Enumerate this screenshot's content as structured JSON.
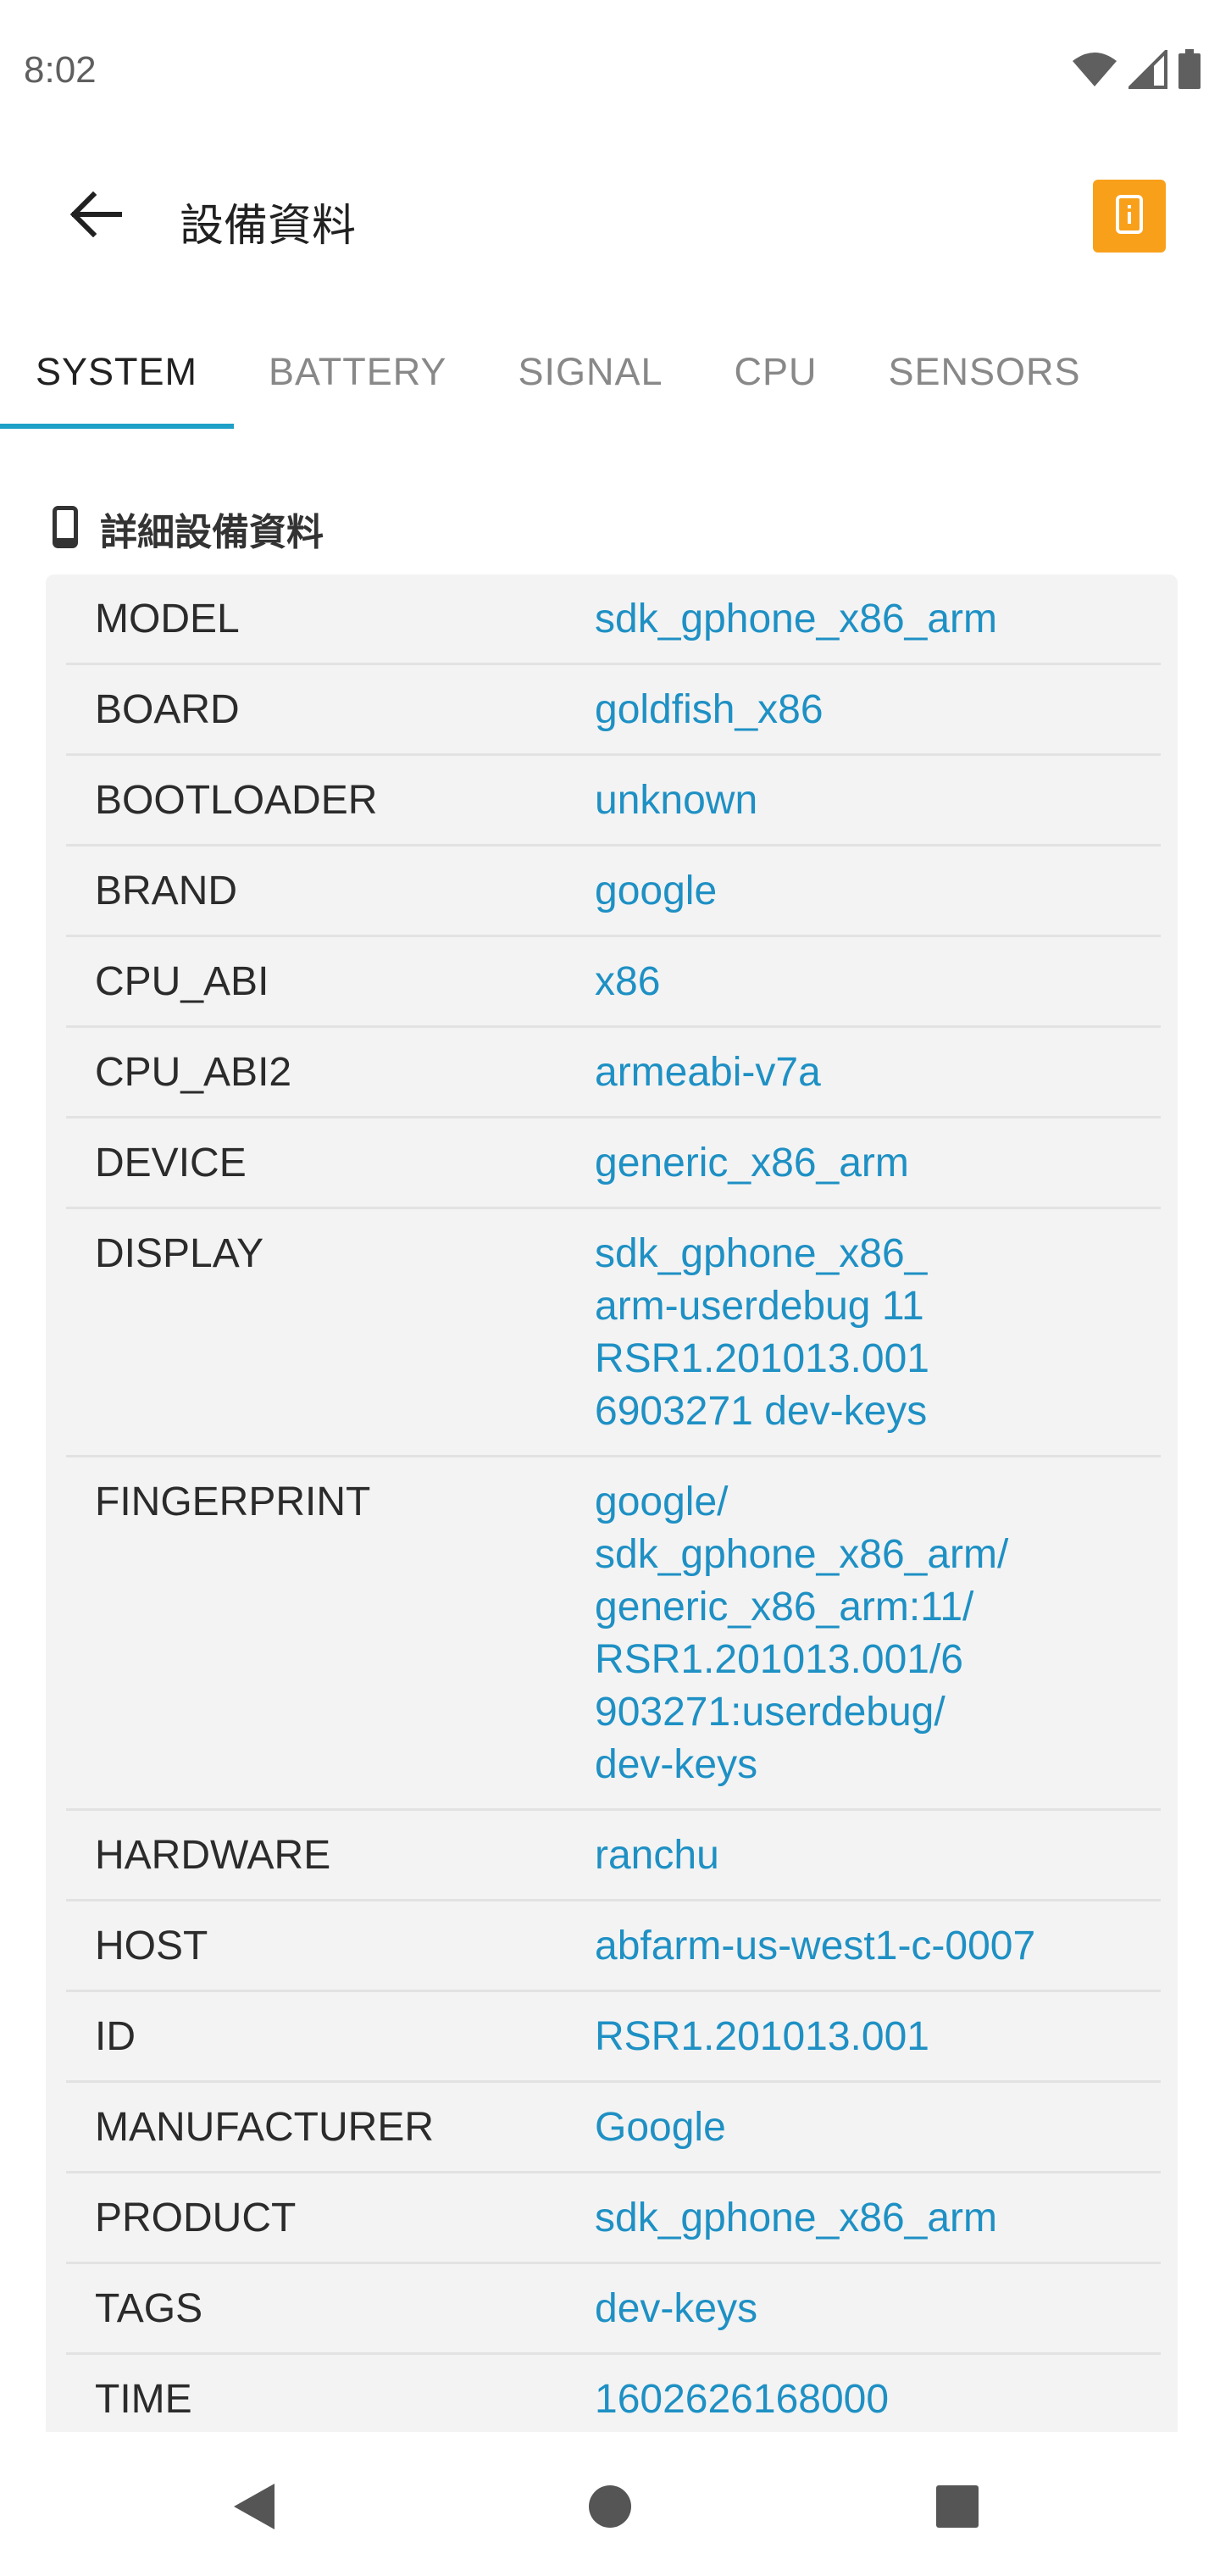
{
  "status_bar": {
    "time": "8:02",
    "icons": [
      "wifi-icon",
      "signal-icon",
      "battery-icon"
    ]
  },
  "app_bar": {
    "title": "設備資料",
    "back_icon": "arrow-left-icon",
    "action_icon": "device-info-icon",
    "action_color": "#f9a01b"
  },
  "tabs": [
    {
      "label": "SYSTEM",
      "active": true
    },
    {
      "label": "BATTERY",
      "active": false
    },
    {
      "label": "SIGNAL",
      "active": false
    },
    {
      "label": "CPU",
      "active": false
    },
    {
      "label": "SENSORS",
      "active": false
    }
  ],
  "section": {
    "icon": "phone-icon",
    "title": "詳細設備資料"
  },
  "details": [
    {
      "key": "MODEL",
      "value": "sdk_gphone_x86_arm"
    },
    {
      "key": "BOARD",
      "value": "goldfish_x86"
    },
    {
      "key": "BOOTLOADER",
      "value": "unknown"
    },
    {
      "key": "BRAND",
      "value": "google"
    },
    {
      "key": "CPU_ABI",
      "value": "x86"
    },
    {
      "key": "CPU_ABI2",
      "value": "armeabi-v7a"
    },
    {
      "key": "DEVICE",
      "value": "generic_x86_arm"
    },
    {
      "key": "DISPLAY",
      "value": "sdk_gphone_x86_\narm-userdebug 11\nRSR1.201013.001\n6903271 dev-keys"
    },
    {
      "key": "FINGERPRINT",
      "value": "google/\nsdk_gphone_x86_arm/\ngeneric_x86_arm:11/\nRSR1.201013.001/6\n903271:userdebug/\ndev-keys"
    },
    {
      "key": "HARDWARE",
      "value": "ranchu"
    },
    {
      "key": "HOST",
      "value": "abfarm-us-west1-c-0007"
    },
    {
      "key": "ID",
      "value": "RSR1.201013.001"
    },
    {
      "key": "MANUFACTURER",
      "value": "Google"
    },
    {
      "key": "PRODUCT",
      "value": "sdk_gphone_x86_arm"
    },
    {
      "key": "TAGS",
      "value": "dev-keys"
    },
    {
      "key": "TIME",
      "value": "1602626168000"
    }
  ],
  "nav_bar": {
    "icons": [
      "back-triangle-icon",
      "home-circle-icon",
      "recents-square-icon"
    ]
  },
  "colors": {
    "accent": "#1ea0c8",
    "value_text": "#1e90c4",
    "card_bg": "#f3f3f3"
  }
}
